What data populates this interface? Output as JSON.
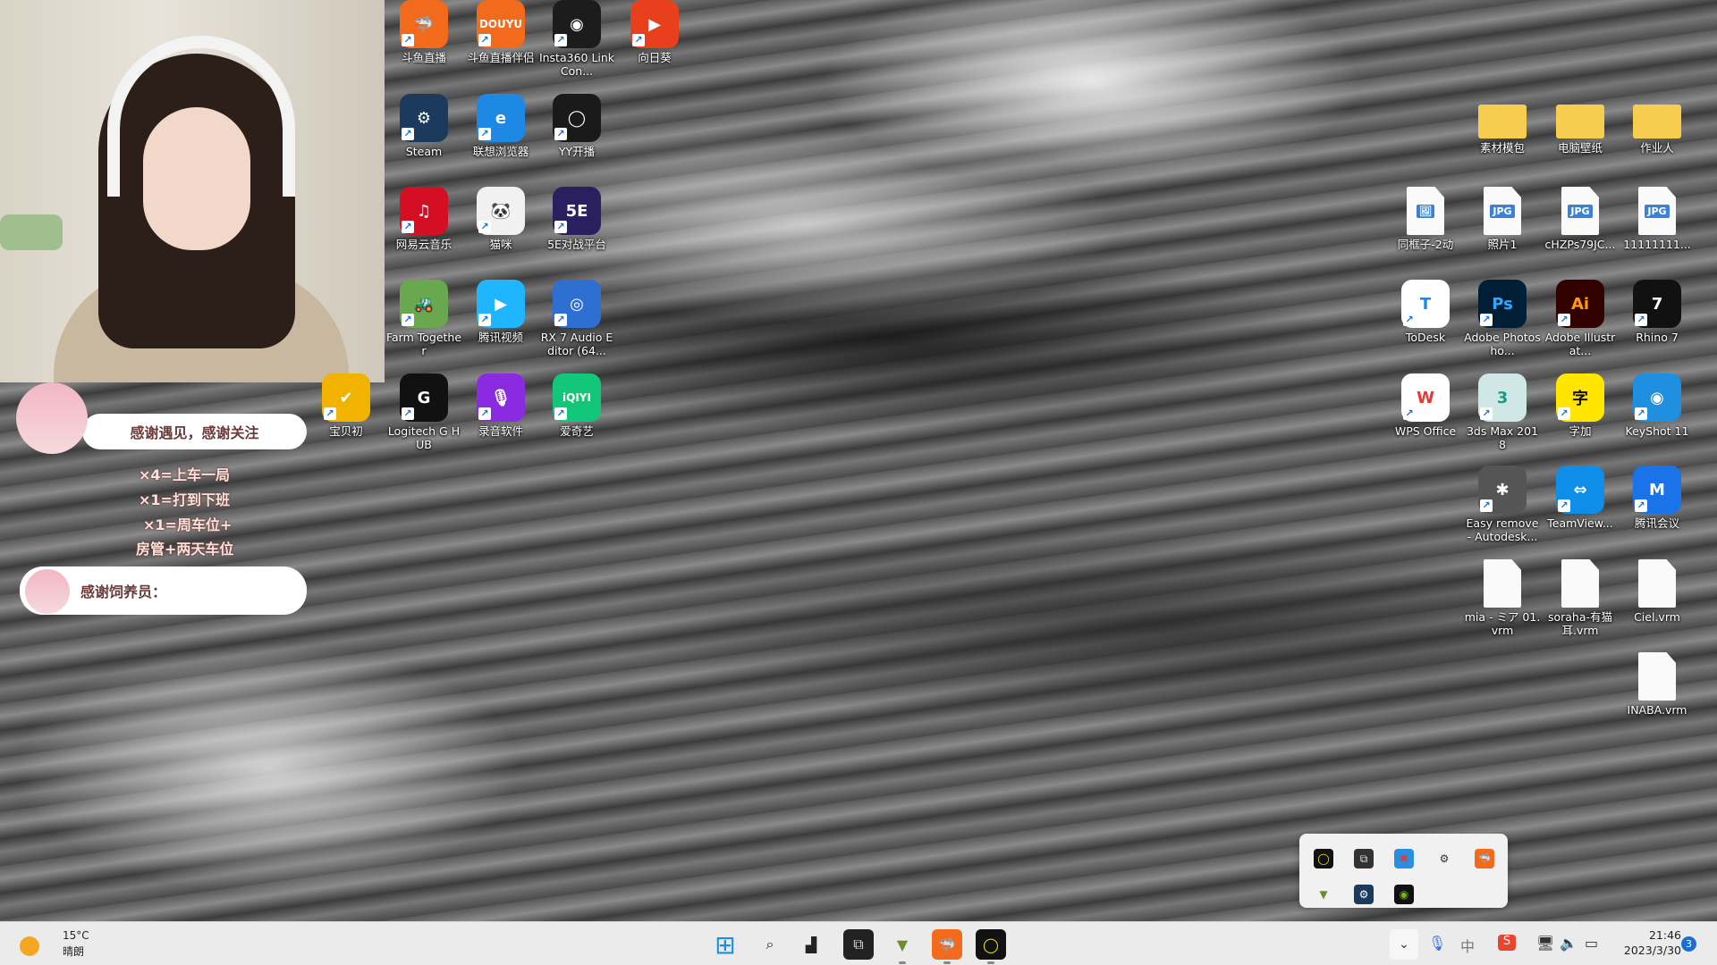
{
  "stream_overlay": {
    "bubble1": "感谢遇见，感谢关注",
    "gift_lines": [
      "×4=上车一局",
      "×1=打到下班",
      "×1=周车位+",
      "房管+两天车位"
    ],
    "bubble2": "感谢饲养员："
  },
  "desktop_left": [
    {
      "label": "斗鱼直播",
      "color": "#f26a1b",
      "glyph": "🦈"
    },
    {
      "label": "斗鱼直播伴侣",
      "color": "#f26a1b",
      "glyph": "DOUYU"
    },
    {
      "label": "Insta360 Link Con...",
      "color": "#1c1c1c",
      "glyph": "◉"
    },
    {
      "label": "向日葵",
      "color": "#e8401c",
      "glyph": "▶"
    },
    {
      "label": "Steam",
      "color": "#1b3a5c",
      "glyph": "⚙"
    },
    {
      "label": "联想浏览器",
      "color": "#1e88e5",
      "glyph": "e"
    },
    {
      "label": "YY开播",
      "color": "#1a1a1a",
      "glyph": "◯"
    },
    {
      "label": "网易云音乐",
      "color": "#d40f24",
      "glyph": "♫"
    },
    {
      "label": "猫咪",
      "color": "#f1f1f1",
      "glyph": "🐼"
    },
    {
      "label": "5E对战平台",
      "color": "#2a2060",
      "glyph": "5E"
    },
    {
      "label": "Farm Together",
      "color": "#6aa84f",
      "glyph": "🚜"
    },
    {
      "label": "腾讯视频",
      "color": "#1fb6ff",
      "glyph": "▶"
    },
    {
      "label": "RX 7 Audio Editor (64...",
      "color": "#2f6fd1",
      "glyph": "◎"
    },
    {
      "label": "Logitech G HUB",
      "color": "#111",
      "glyph": "G"
    },
    {
      "label": "录音软件",
      "color": "#8a2be2",
      "glyph": "🎙"
    },
    {
      "label": "爱奇艺",
      "color": "#12c77a",
      "glyph": "iQIYI"
    },
    {
      "label": "宝贝初",
      "color": "#f1b300",
      "glyph": "✔"
    }
  ],
  "desktop_right": [
    {
      "label": "素材模包",
      "type": "folder"
    },
    {
      "label": "电脑壁纸",
      "type": "folder"
    },
    {
      "label": "作业人",
      "type": "folder"
    },
    {
      "label": "同框子-2动",
      "type": "file",
      "glyph": "🖼"
    },
    {
      "label": "照片1",
      "type": "file",
      "glyph": "JPG"
    },
    {
      "label": "cHZPs79JC...",
      "type": "file",
      "glyph": "JPG"
    },
    {
      "label": "11111111...",
      "type": "file",
      "glyph": "JPG"
    },
    {
      "label": "ToDesk",
      "color": "#ffffff",
      "glyph": "T",
      "fg": "#1e88e5"
    },
    {
      "label": "Adobe Photosho...",
      "color": "#001e36",
      "glyph": "Ps",
      "fg": "#31a8ff"
    },
    {
      "label": "Adobe Illustrat...",
      "color": "#330000",
      "glyph": "Ai",
      "fg": "#ff9a00"
    },
    {
      "label": "Rhino 7",
      "color": "#111",
      "glyph": "7"
    },
    {
      "label": "WPS Office",
      "color": "#ffffff",
      "glyph": "W",
      "fg": "#e53935"
    },
    {
      "label": "3ds Max 2018",
      "color": "#cfe8e6",
      "glyph": "3",
      "fg": "#139e8a"
    },
    {
      "label": "字加",
      "color": "#ffe500",
      "glyph": "字",
      "fg": "#111"
    },
    {
      "label": "KeyShot 11",
      "color": "#1f8fe0",
      "glyph": "◉"
    },
    {
      "label": "Easy remove - Autodesk...",
      "color": "#555",
      "glyph": "✱"
    },
    {
      "label": "TeamView...",
      "color": "#0e8ee9",
      "glyph": "⇔"
    },
    {
      "label": "腾讯会议",
      "color": "#1a73e8",
      "glyph": "M"
    },
    {
      "label": "mia - ミア 01.vrm",
      "type": "file"
    },
    {
      "label": "soraha-有猫耳.vrm",
      "type": "file"
    },
    {
      "label": "Ciel.vrm",
      "type": "file"
    },
    {
      "label": "INABA.vrm",
      "type": "file"
    }
  ],
  "taskbar": {
    "weather": {
      "temp": "15°C",
      "condition": "晴朗"
    },
    "apps": [
      {
        "name": "start-icon",
        "glyph": "⊞",
        "color": "#1a8fe3",
        "bg": "transparent",
        "running": false
      },
      {
        "name": "search-icon",
        "glyph": "⌕",
        "color": "#222",
        "bg": "transparent",
        "running": false
      },
      {
        "name": "task-view-icon",
        "glyph": "▟",
        "color": "#222",
        "bg": "transparent",
        "running": false
      },
      {
        "name": "app-icon-box",
        "glyph": "⧉",
        "color": "#ddd",
        "bg": "#222",
        "running": false
      },
      {
        "name": "app-icon-shield",
        "glyph": "▼",
        "color": "#6a8f2a",
        "bg": "transparent",
        "running": true
      },
      {
        "name": "app-icon-douyu",
        "glyph": "🦈",
        "color": "#fff",
        "bg": "#f26a1b",
        "running": true
      },
      {
        "name": "app-icon-yy",
        "glyph": "◯",
        "color": "#e6e600",
        "bg": "#111",
        "running": true
      }
    ],
    "ime": "中",
    "time": "21:46",
    "date": "2023/3/30",
    "notification_count": "3"
  },
  "tray_popup": [
    {
      "name": "yy-icon",
      "glyph": "◯",
      "color": "#e6e600",
      "bg": "#111"
    },
    {
      "name": "box-icon",
      "glyph": "⧉",
      "color": "#ddd",
      "bg": "#333"
    },
    {
      "name": "defender-icon",
      "glyph": "✖",
      "color": "#e53935",
      "bg": "#2a8fe0"
    },
    {
      "name": "steelseries-icon",
      "glyph": "⚙",
      "color": "#333",
      "bg": "transparent"
    },
    {
      "name": "douyu-icon",
      "glyph": "🦈",
      "color": "#fff",
      "bg": "#f26a1b"
    },
    {
      "name": "shield-icon",
      "glyph": "▼",
      "color": "#6a8f2a",
      "bg": "transparent"
    },
    {
      "name": "steam-icon",
      "glyph": "⚙",
      "color": "#fff",
      "bg": "#1b3a5c"
    },
    {
      "name": "nvidia-icon",
      "glyph": "◉",
      "color": "#76b900",
      "bg": "#111"
    }
  ]
}
